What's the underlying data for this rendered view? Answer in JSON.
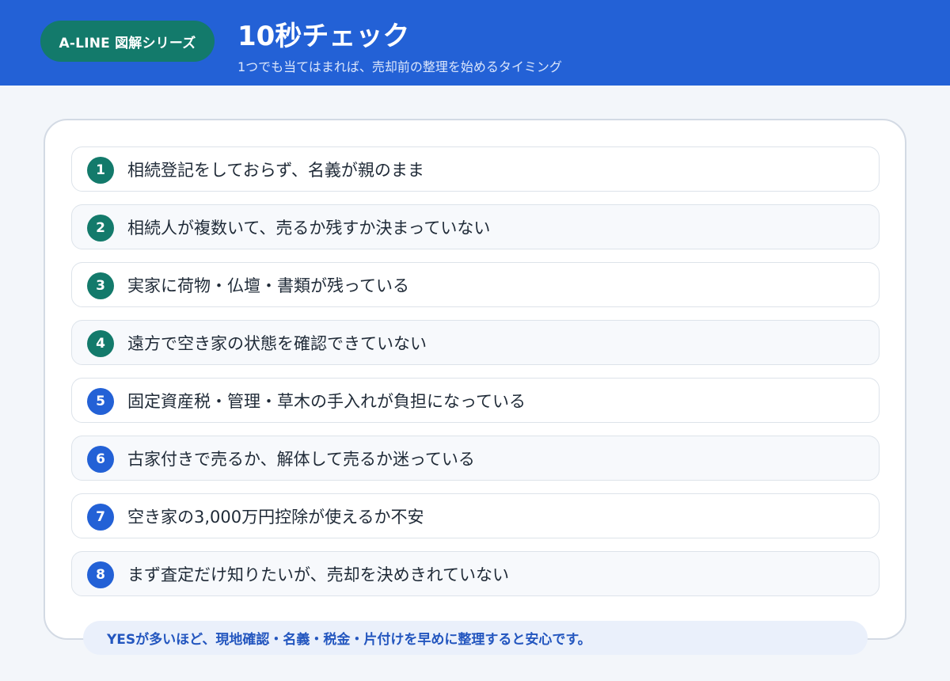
{
  "header": {
    "badge": "A-LINE 図解シリーズ",
    "title": "10秒チェック",
    "subtitle": "1つでも当てはまれば、売却前の整理を始めるタイミング"
  },
  "checklist": [
    {
      "number": "1",
      "text": "相続登記をしておらず、名義が親のまま",
      "color": "#137a6b"
    },
    {
      "number": "2",
      "text": "相続人が複数いて、売るか残すか決まっていない",
      "color": "#137a6b"
    },
    {
      "number": "3",
      "text": "実家に荷物・仏壇・書類が残っている",
      "color": "#137a6b"
    },
    {
      "number": "4",
      "text": "遠方で空き家の状態を確認できていない",
      "color": "#137a6b"
    },
    {
      "number": "5",
      "text": "固定資産税・管理・草木の手入れが負担になっている",
      "color": "#2361d6"
    },
    {
      "number": "6",
      "text": "古家付きで売るか、解体して売るか迷っている",
      "color": "#2361d6"
    },
    {
      "number": "7",
      "text": "空き家の3,000万円控除が使えるか不安",
      "color": "#2361d6"
    },
    {
      "number": "8",
      "text": "まず査定だけ知りたいが、売却を決めきれていない",
      "color": "#2361d6"
    }
  ],
  "footer": {
    "note": "YESが多いほど、現地確認・名義・税金・片付けを早めに整理すると安心です。"
  },
  "colors": {
    "header_bg": "#2361d6",
    "badge_bg": "#137a6b",
    "green_accent": "#137a6b",
    "blue_accent": "#2361d6",
    "page_bg": "#f3f6fa"
  }
}
